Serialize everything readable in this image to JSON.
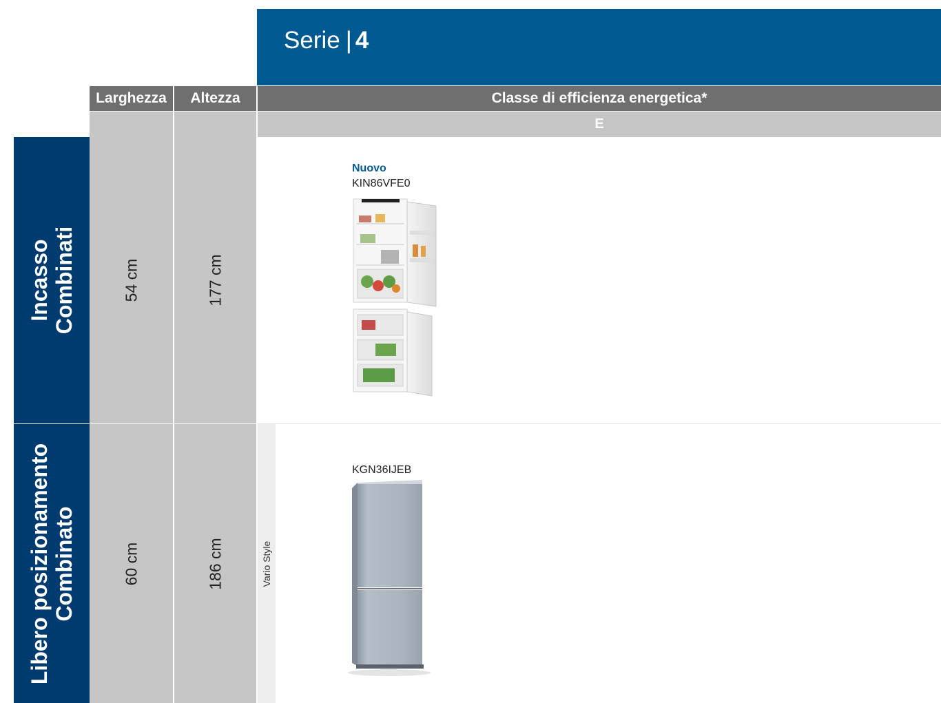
{
  "banner": {
    "series_label": "Serie",
    "separator": "|",
    "series_number": "4"
  },
  "header": {
    "width_label": "Larghezza",
    "height_label": "Altezza",
    "class_label": "Classe di efficienza energetica*",
    "class_value": "E"
  },
  "categories": [
    {
      "line1": "Incasso",
      "line2": "Combinati",
      "width": "54 cm",
      "height": "177 cm",
      "product": {
        "badge": "Nuovo",
        "model": "KIN86VFE0"
      }
    },
    {
      "line1": "Libero posizionamento",
      "line2": "Combinato",
      "width": "60 cm",
      "height": "186 cm",
      "subgroup": "Vario Style",
      "product": {
        "model": "KGN36IJEB"
      }
    }
  ],
  "colors": {
    "banner_blue": "#005a92",
    "category_navy": "#003b6f",
    "header_gray": "#6f6f6f",
    "column_gray": "#c6c6c6"
  }
}
